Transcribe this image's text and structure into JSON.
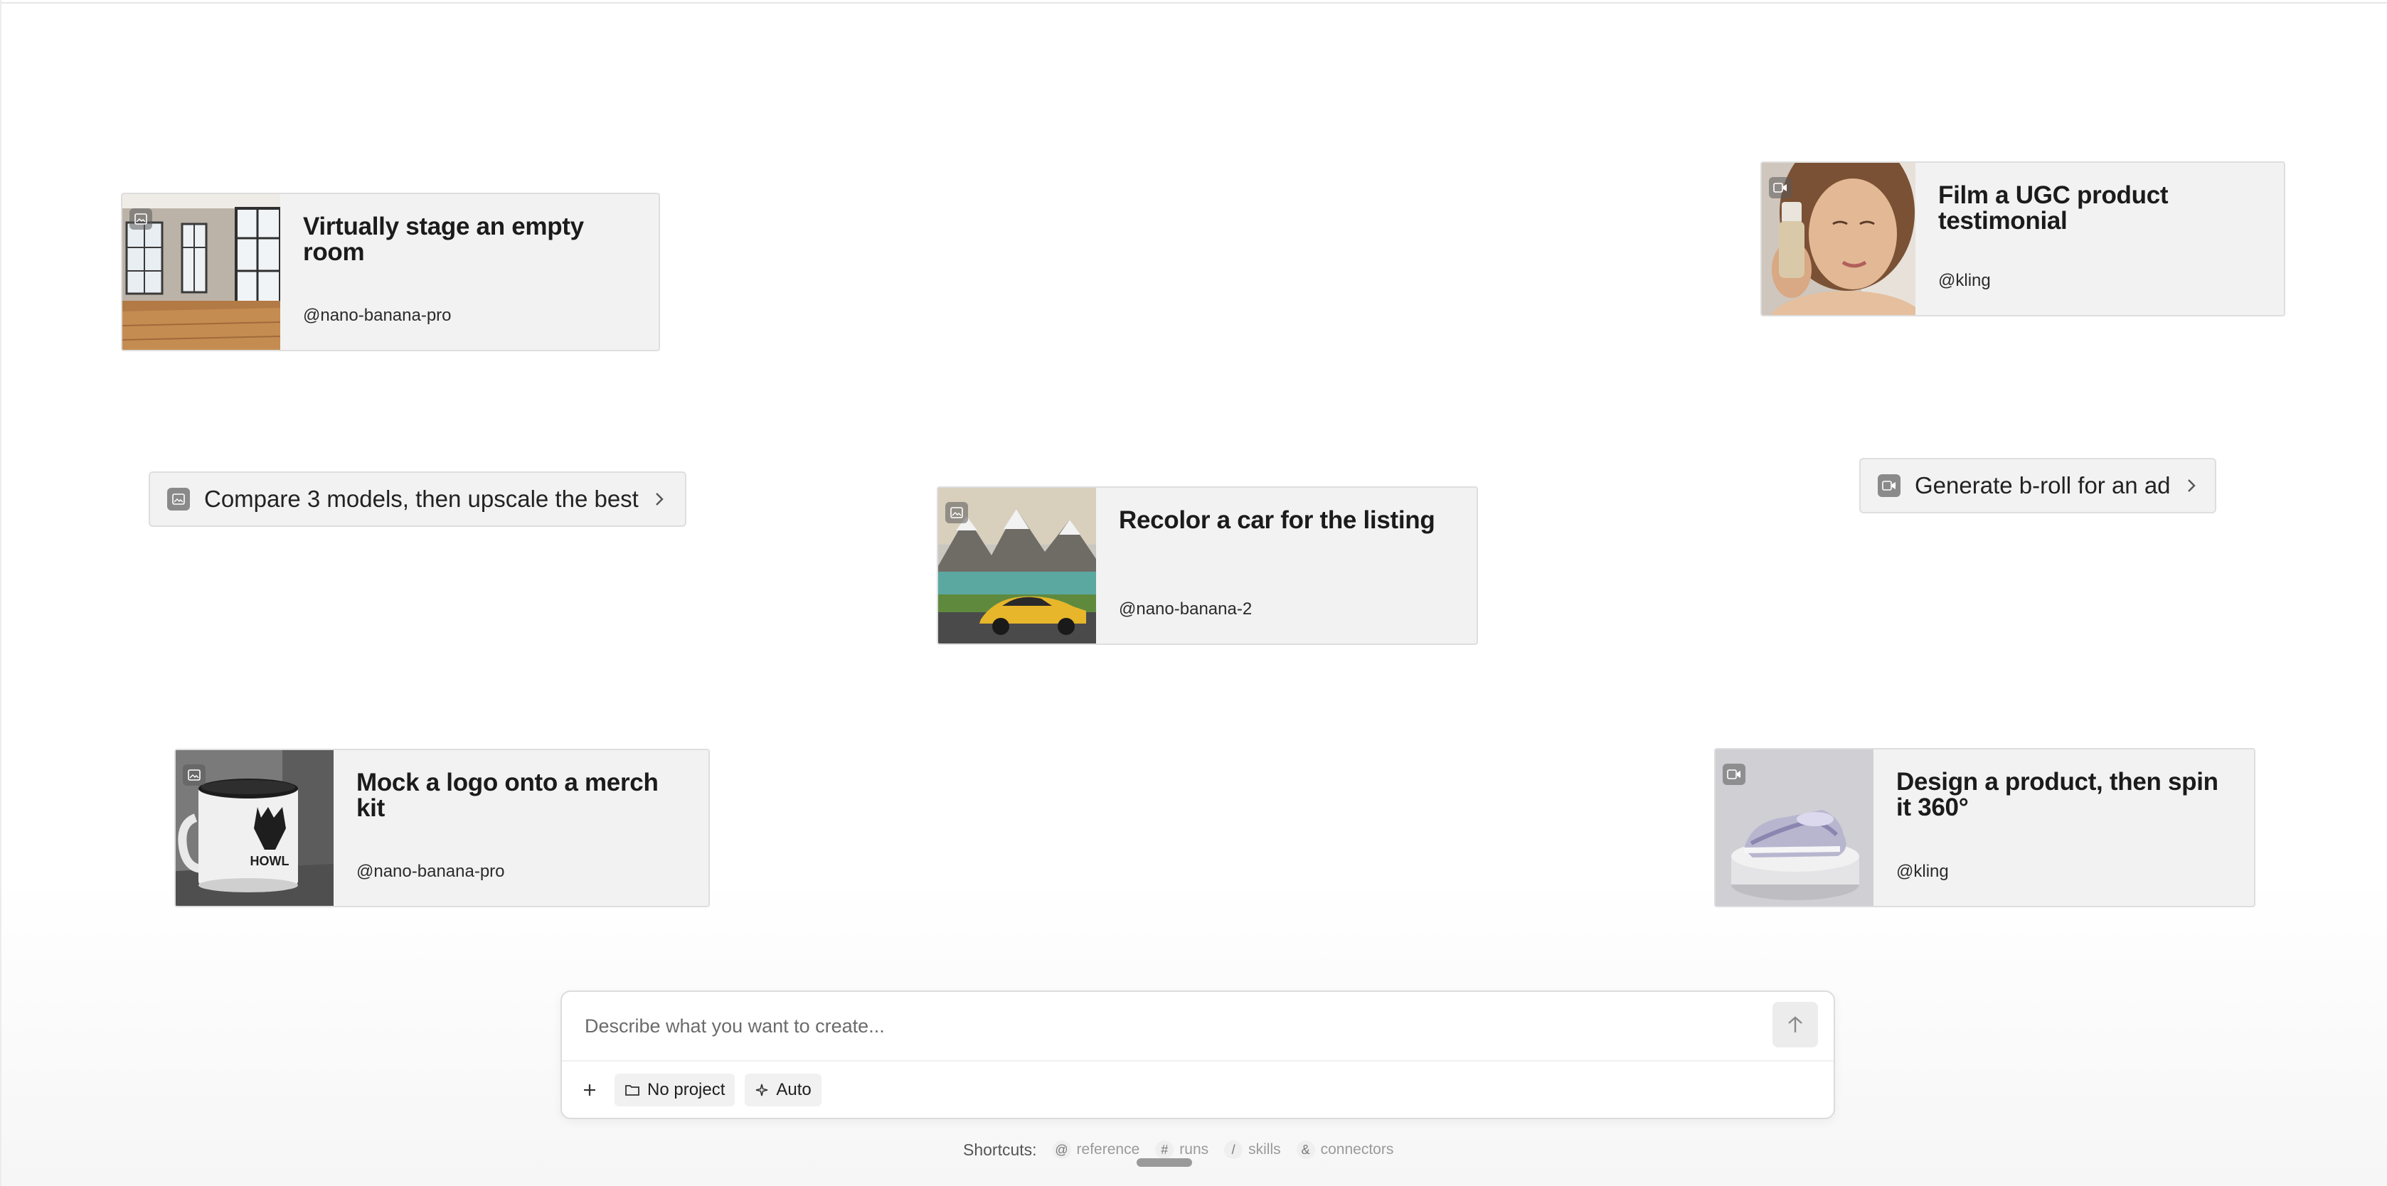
{
  "cards": [
    {
      "title": "Virtually stage an empty room",
      "handle": "@nano-banana-pro",
      "media": "image-icon"
    },
    {
      "title": "Film a UGC product testimonial",
      "handle": "@kling",
      "media": "video-icon"
    },
    {
      "title": "Recolor a car for the listing",
      "handle": "@nano-banana-2",
      "media": "image-icon"
    },
    {
      "title": "Mock a logo onto a merch kit",
      "handle": "@nano-banana-pro",
      "media": "image-icon"
    },
    {
      "title": "Design a product, then spin it 360°",
      "handle": "@kling",
      "media": "video-icon"
    }
  ],
  "chips": [
    {
      "label": "Compare 3 models, then upscale the best",
      "media": "image-icon"
    },
    {
      "label": "Generate b-roll for an ad",
      "media": "video-icon"
    }
  ],
  "thumbnails": {
    "mug_text": "HOWL"
  },
  "composer": {
    "placeholder": "Describe what you want to create...",
    "project_label": "No project",
    "mode_label": "Auto"
  },
  "shortcuts": {
    "label": "Shortcuts:",
    "items": [
      {
        "key": "@",
        "label": "reference"
      },
      {
        "key": "#",
        "label": "runs"
      },
      {
        "key": "/",
        "label": "skills"
      },
      {
        "key": "&",
        "label": "connectors"
      }
    ]
  },
  "colors": {
    "card_bg": "#f2f2f2",
    "card_border": "#dedede",
    "text": "#1b1b1b",
    "muted": "#9a9a9a"
  }
}
